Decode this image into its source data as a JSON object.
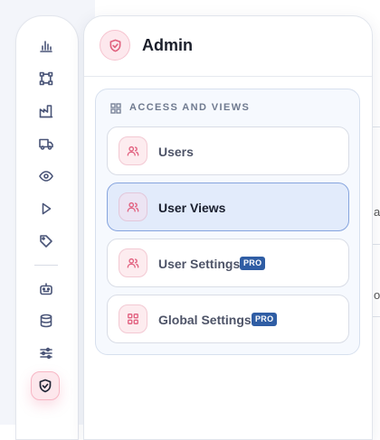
{
  "panel": {
    "title": "Admin",
    "group_title": "ACCESS AND VIEWS",
    "items": [
      {
        "label": "Users",
        "icon": "users-icon",
        "badge": "",
        "active": false
      },
      {
        "label": "User Views",
        "icon": "users-icon",
        "badge": "",
        "active": true
      },
      {
        "label": "User Settings",
        "icon": "users-icon",
        "badge": "PRO",
        "active": false
      },
      {
        "label": "Global Settings",
        "icon": "grid-icon",
        "badge": "PRO",
        "active": false
      }
    ]
  },
  "rail": {
    "icons": [
      "bar-chart-icon",
      "workflow-icon",
      "factory-icon",
      "truck-icon",
      "eye-icon",
      "play-icon",
      "tag-icon",
      "robot-icon",
      "database-icon",
      "sliders-icon",
      "shield-check-icon"
    ],
    "active": "shield-check-icon"
  },
  "background": {
    "edge_chars": [
      "a",
      "o"
    ]
  },
  "colors": {
    "accent_pink": "#e26482",
    "active_blue_bg": "#e2ebfb",
    "badge_blue": "#2f5da4"
  }
}
